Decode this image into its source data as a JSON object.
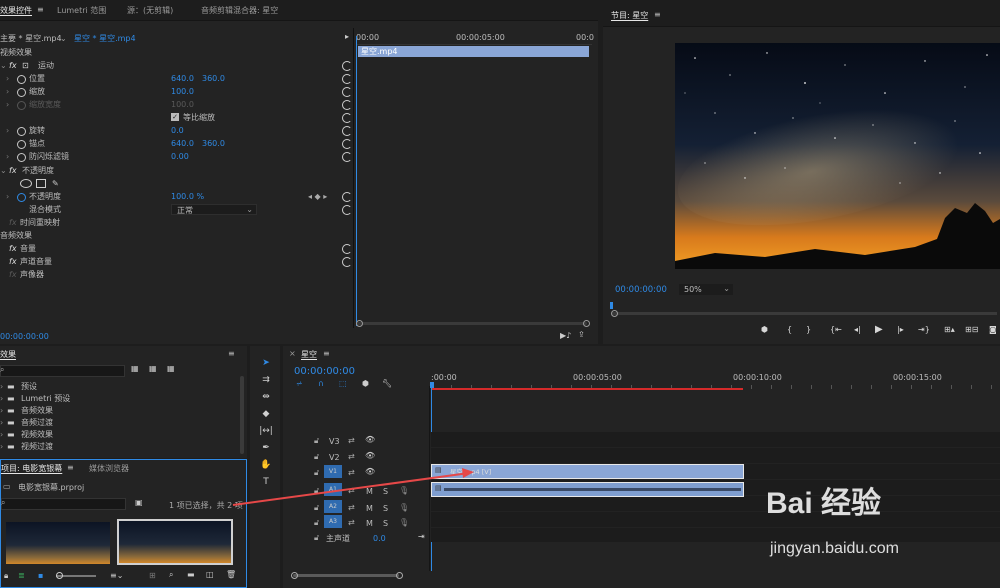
{
  "ec_tabs": [
    "效果控件",
    "Lumetri 范围",
    "源：(无剪辑)",
    "音频剪辑混合器: 星空"
  ],
  "ec_master": "主要 * 星空.mp4",
  "ec_seq": "星空 * 星空.mp4",
  "ec_ruler": {
    "t0": "00:00",
    "t1": "00:00:05:00",
    "t2": "00:0"
  },
  "ec_clip": "星空.mp4",
  "video_effects": "视频效果",
  "motion": "运动",
  "position": {
    "label": "位置",
    "x": "640.0",
    "y": "360.0"
  },
  "scale": {
    "label": "缩放",
    "value": "100.0"
  },
  "scale_width": {
    "label": "缩放宽度",
    "value": "100.0"
  },
  "uniform": "等比缩放",
  "rotation": {
    "label": "旋转",
    "value": "0.0"
  },
  "anchor": {
    "label": "锚点",
    "x": "640.0",
    "y": "360.0"
  },
  "antiflicker": {
    "label": "防闪烁滤镜",
    "value": "0.00"
  },
  "opacity_section": "不透明度",
  "opacity": {
    "label": "不透明度",
    "value": "100.0 %"
  },
  "blend": {
    "label": "混合模式",
    "value": "正常"
  },
  "time_remap": "时间重映射",
  "audio_effects": "音频效果",
  "volume": "音量",
  "channel_vol": "声道音量",
  "panner": "声像器",
  "ec_timecode": "00:00:00:00",
  "program": {
    "title": "节目: 星空",
    "timecode": "00:00:00:00",
    "zoom": "50%"
  },
  "effects_panel": {
    "title": "效果",
    "items": [
      "预设",
      "Lumetri 预设",
      "音频效果",
      "音频过渡",
      "视频效果",
      "视频过渡"
    ]
  },
  "project": {
    "tab1": "项目: 电影宽银幕",
    "tab2": "媒体浏览器",
    "file": "电影宽银幕.prproj",
    "status": "1 项已选择，共 2 项"
  },
  "timeline": {
    "tab": "星空",
    "timecode": "00:00:00:00",
    "ruler": [
      ":00:00",
      "00:00:05:00",
      "00:00:10:00",
      "00:00:15:00"
    ],
    "tracks_v": [
      "V3",
      "V2",
      "V1"
    ],
    "tracks_a": [
      "A1",
      "A2",
      "A3"
    ],
    "master": "主声道",
    "master_val": "0.0",
    "clip_label": "星空.mp4 [V]",
    "m": "M",
    "s": "S"
  },
  "watermark": {
    "brand": "Bai 经验",
    "url": "jingyan.baidu.com"
  },
  "colors": {
    "accent": "#2f8ae5",
    "clip_video": "#8aa6d6",
    "clip_audio": "#7f9ed0",
    "play_range": "#d52a2a",
    "arrow": "#e64848"
  }
}
